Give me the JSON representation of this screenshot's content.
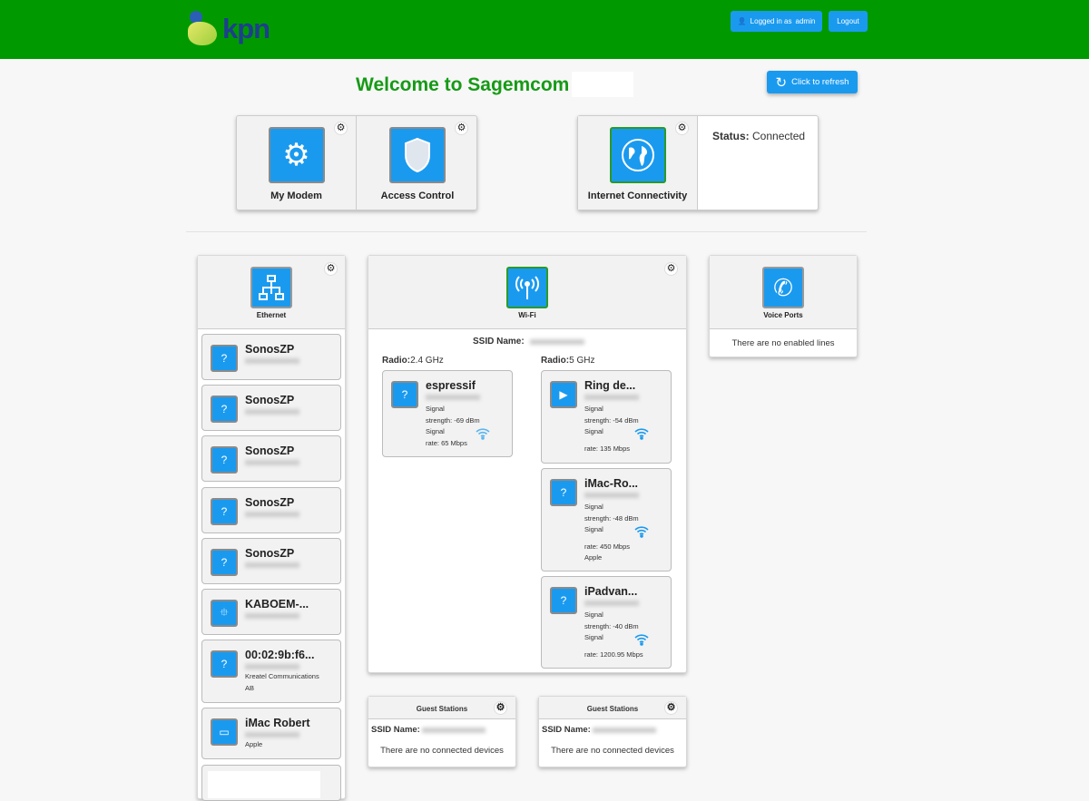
{
  "header": {
    "brand": "kpn",
    "logged_in_label": "Logged in as",
    "user": "admin",
    "logout": "Logout"
  },
  "title": "Welcome to Sagemcom",
  "refresh": "Click to refresh",
  "tiles": {
    "modem": "My Modem",
    "access": "Access Control",
    "internet": "Internet Connectivity",
    "status_label": "Status:",
    "status_value": "Connected"
  },
  "ethernet": {
    "label": "Ethernet",
    "devices": [
      {
        "name": "SonosZP",
        "icon": "question-icon"
      },
      {
        "name": "SonosZP",
        "icon": "question-icon"
      },
      {
        "name": "SonosZP",
        "icon": "question-icon"
      },
      {
        "name": "SonosZP",
        "icon": "question-icon"
      },
      {
        "name": "SonosZP",
        "icon": "question-icon"
      },
      {
        "name": "KABOEM-...",
        "icon": "usb-icon"
      },
      {
        "name": "00:02:9b:f6...",
        "icon": "question-icon",
        "vendor": "Kreatel Communications AB"
      },
      {
        "name": "iMac Robert",
        "icon": "monitor-icon",
        "vendor": "Apple"
      }
    ]
  },
  "wifi": {
    "label": "Wi-Fi",
    "ssid_label": "SSID Name:",
    "radios": [
      {
        "label": "Radio:",
        "band": "2.4 GHz",
        "devices": [
          {
            "name": "espressif",
            "icon": "question-icon",
            "strength": "strength: -69 dBm",
            "rate": "rate: 65 Mbps"
          }
        ]
      },
      {
        "label": "Radio:",
        "band": "5 GHz",
        "devices": [
          {
            "name": "Ring de...",
            "icon": "media-icon",
            "strength": "strength: -54 dBm",
            "rate": "rate: 135 Mbps"
          },
          {
            "name": "iMac-Ro...",
            "icon": "question-icon",
            "strength": "strength: -48 dBm",
            "rate": "rate: 450 Mbps",
            "vendor": "Apple"
          },
          {
            "name": "iPadvan...",
            "icon": "question-icon",
            "strength": "strength: -40 dBm",
            "rate": "rate: 1200.95 Mbps"
          }
        ]
      }
    ],
    "signal_label": "Signal"
  },
  "voice": {
    "label": "Voice Ports",
    "empty": "There are no enabled lines"
  },
  "guest": [
    {
      "title": "Guest Stations",
      "ssid_label": "SSID Name:",
      "empty": "There are no connected devices"
    },
    {
      "title": "Guest Stations",
      "ssid_label": "SSID Name:",
      "empty": "There are no connected devices"
    }
  ],
  "colors": {
    "header": "#009a00",
    "accent": "#1a9aef",
    "title": "#169a16"
  }
}
